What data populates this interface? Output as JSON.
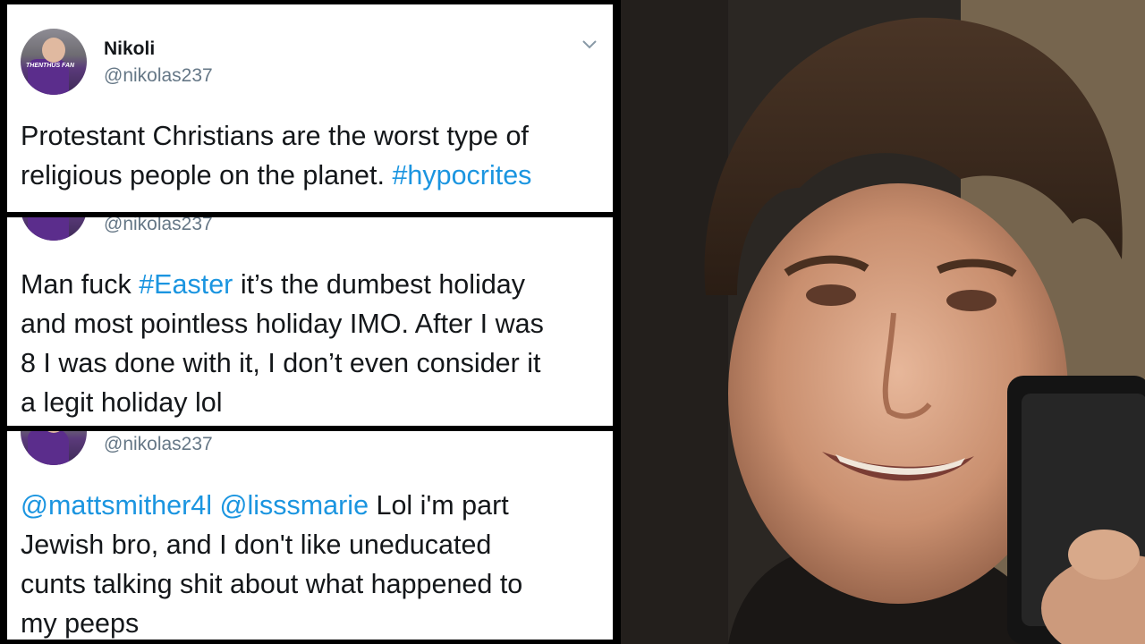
{
  "tweets": [
    {
      "name": "Nikoli",
      "handle": "@nikolas237",
      "text_lines": [
        "Protestant Christians are the worst type of",
        "religious people on the planet. "
      ],
      "hashtag": "#hypocrites",
      "avatar_badge": "THENTHUS FAN"
    },
    {
      "handle": "@nikolas237",
      "line1_pre": "Man fuck ",
      "line1_hashtag": "#Easter",
      "line1_post": " it’s the dumbest holiday",
      "line2": "and most pointless holiday IMO. After I was",
      "line3": "8 I was done with it, I don’t even consider it",
      "line4": "a legit holiday lol"
    },
    {
      "handle": "@nikolas237",
      "mention1": "@mattsmither4l",
      "mention2": "@lisssmarie",
      "line1_post": " Lol i'm part",
      "line2": "Jewish bro, and I don't like uneducated",
      "line3": "cunts talking shit about what happened to",
      "line4": "my peeps"
    }
  ],
  "icons": {
    "menu": "chevron-down-icon"
  },
  "colors": {
    "link": "#1b95e0",
    "handle": "#657786",
    "text": "#14171a"
  }
}
